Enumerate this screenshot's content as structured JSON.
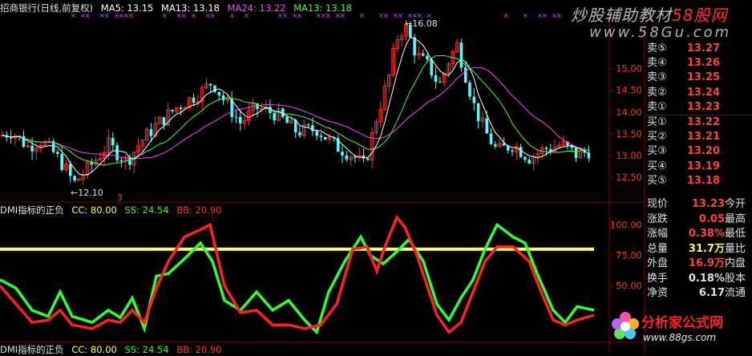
{
  "header": {
    "stock_name": "招商银行(日线,前复权)",
    "ma5": "MA5: 13.15",
    "ma13a": "MA13: 13.18",
    "ma24": "MA24: 13.22",
    "ma13b": "MA13: 13.18"
  },
  "indicator": {
    "title": "DMI指标的正负",
    "cc": "CC: 80.00",
    "ss": "SS: 24.54",
    "bb": "BB: 20.90"
  },
  "indicator2": {
    "title": "DMI指标的正负",
    "cc": "CC: 80.00",
    "ss": "SS: 24.54",
    "bb": "BB: 20.90"
  },
  "annotations": {
    "high": "←16.08",
    "low": "←12.10",
    "marker": "3"
  },
  "price_axis": [
    "15.00",
    "14.50",
    "14.00",
    "13.50",
    "13.00",
    "12.50"
  ],
  "ind_axis": [
    "100.00",
    "75.00",
    "50.00"
  ],
  "quotes": {
    "asks": [
      {
        "label": "卖⑤",
        "value": "13.27"
      },
      {
        "label": "卖④",
        "value": "13.26"
      },
      {
        "label": "卖③",
        "value": "13.25"
      },
      {
        "label": "卖②",
        "value": "13.24"
      },
      {
        "label": "卖①",
        "value": "13.23"
      }
    ],
    "bids": [
      {
        "label": "买①",
        "value": "13.22"
      },
      {
        "label": "买②",
        "value": "13.21"
      },
      {
        "label": "买③",
        "value": "13.20"
      },
      {
        "label": "买④",
        "value": "13.19"
      },
      {
        "label": "买⑤",
        "value": "13.18"
      }
    ]
  },
  "stats": [
    {
      "label": "现价",
      "value": "13.23",
      "label2": "今开",
      "color": "#ff4040"
    },
    {
      "label": "涨跌",
      "value": "0.05",
      "label2": "最高",
      "color": "#ff4040"
    },
    {
      "label": "涨幅",
      "value": "0.38%",
      "label2": "最低",
      "color": "#ff4040"
    },
    {
      "label": "总量",
      "value": "31.7万",
      "label2": "量比",
      "color": "#ffff40"
    },
    {
      "label": "外盘",
      "value": "16.9万",
      "label2": "内盘",
      "color": "#ff4040"
    },
    {
      "label": "换手",
      "value": "0.18%",
      "label2": "股本",
      "color": "#e0e0e0"
    },
    {
      "label": "净资",
      "value": "6.17",
      "label2": "流通",
      "color": "#e0e0e0"
    }
  ],
  "watermark": {
    "text1": "炒股辅助教材",
    "text1_red": "58股网",
    "text2": "www.58Gu.com"
  },
  "brand": {
    "name": "分析家公式网",
    "url": "www.88gs.com"
  },
  "colors": {
    "up": "#ff3030",
    "down": "#54fcfc",
    "ma5": "#ffffff",
    "ma13": "#40ff40",
    "ma24": "#ff40ff",
    "ss": "#30ff30",
    "bb": "#ff2020",
    "cc": "#ffff60"
  },
  "chart_data": {
    "type": "candlestick-with-indicator",
    "price_range": [
      12.1,
      16.08
    ],
    "indicator_range": [
      0,
      110
    ],
    "cc_level": 80,
    "ss_last": 24.54,
    "bb_last": 20.9
  }
}
